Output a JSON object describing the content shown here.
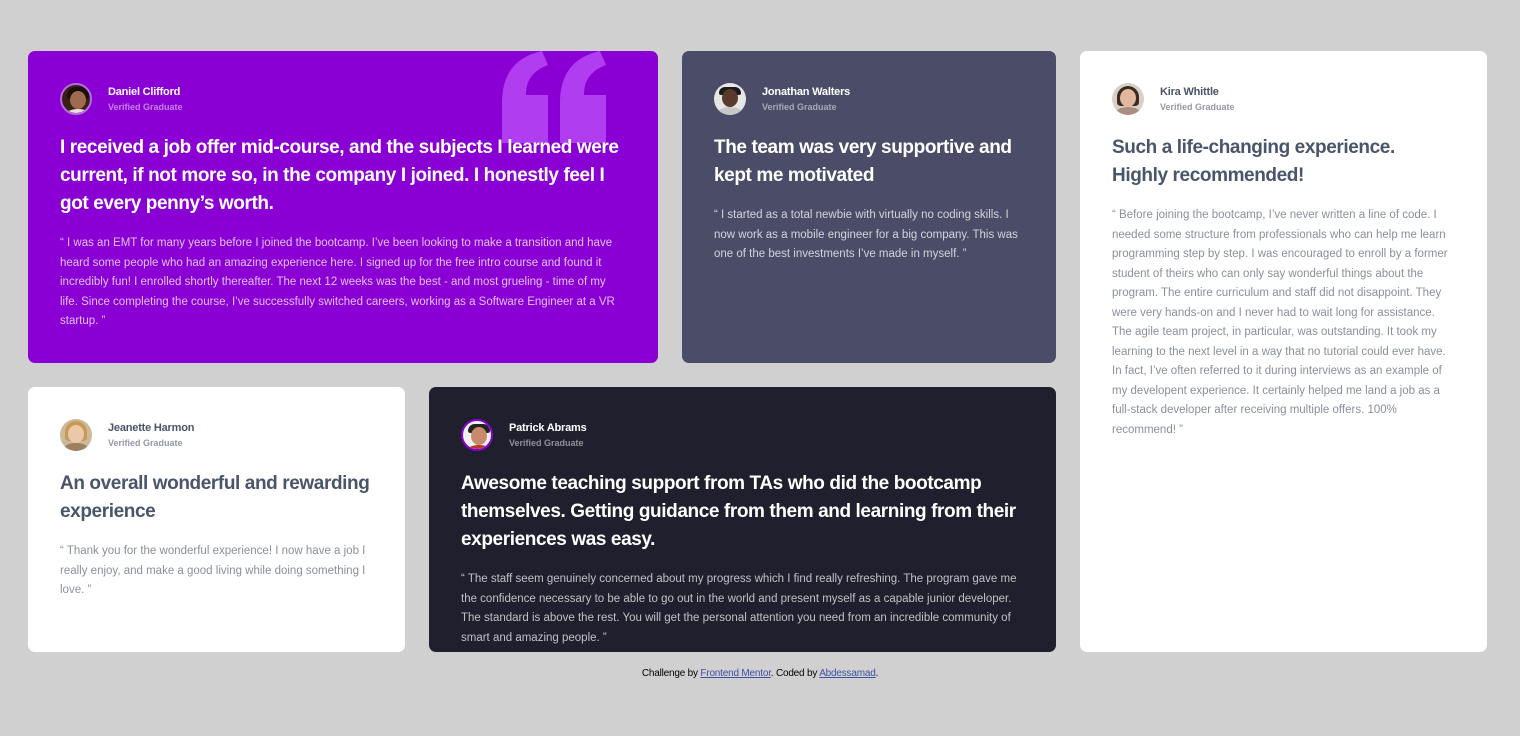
{
  "testimonials": [
    {
      "name": "Daniel Clifford",
      "role": "Verified Graduate",
      "headline": "I received a job offer mid-course, and the subjects I learned were current, if not more so, in the company I joined. I honestly feel I got every penny’s worth.",
      "quote": "“ I was an EMT for many years before I joined the bootcamp. I’ve been looking to make a transition and have heard some people who had an amazing experience here. I signed up for the free intro course and found it incredibly fun! I enrolled shortly thereafter. The next 12 weeks was the best - and most grueling - time of my life. Since completing the course, I’ve successfully switched careers, working as a Software Engineer at a VR startup. ”",
      "color": "#8a00d4"
    },
    {
      "name": "Jonathan Walters",
      "role": "Verified Graduate",
      "headline": "The team was very supportive and kept me motivated",
      "quote": "“ I started as a total newbie with virtually no coding skills. I now work as a mobile engineer for a big company. This was one of the best investments I’ve made in myself. ”",
      "color": "#4b4d68"
    },
    {
      "name": "Kira Whittle",
      "role": "Verified Graduate",
      "headline": "Such a life-changing experience. Highly recommended!",
      "quote": "“ Before joining the bootcamp, I’ve never written a line of code. I needed some structure from professionals who can help me learn programming step by step. I was encouraged to enroll by a former student of theirs who can only say wonderful things about the program. The entire curriculum and staff did not disappoint. They were very hands-on and I never had to wait long for assistance. The agile team project, in particular, was outstanding. It took my learning to the next level in a way that no tutorial could ever have. In fact, I’ve often referred to it during interviews as an example of my developent experience. It certainly helped me land a job as a full-stack developer after receiving multiple offers. 100% recommend! ”",
      "color": "#ffffff"
    },
    {
      "name": "Jeanette Harmon",
      "role": "Verified Graduate",
      "headline": "An overall wonderful and rewarding experience",
      "quote": "“ Thank you for the wonderful experience! I now have a job I really enjoy, and make a good living while doing something I love. ”",
      "color": "#ffffff"
    },
    {
      "name": "Patrick Abrams",
      "role": "Verified Graduate",
      "headline": "Awesome teaching support from TAs who did the bootcamp themselves. Getting guidance from them and learning from their experiences was easy.",
      "quote": "“ The staff seem genuinely concerned about my progress which I find really refreshing. The program gave me the confidence necessary to be able to go out in the world and present myself as a capable junior developer. The standard is above the rest. You will get the personal attention you need from an incredible community of smart and amazing people. ”",
      "color": "#1f1f2d"
    }
  ],
  "footer": {
    "prefix": "Challenge by ",
    "link1": "Frontend Mentor",
    "middle": ". Coded by ",
    "link2": "Abdessamad",
    "suffix": "."
  }
}
